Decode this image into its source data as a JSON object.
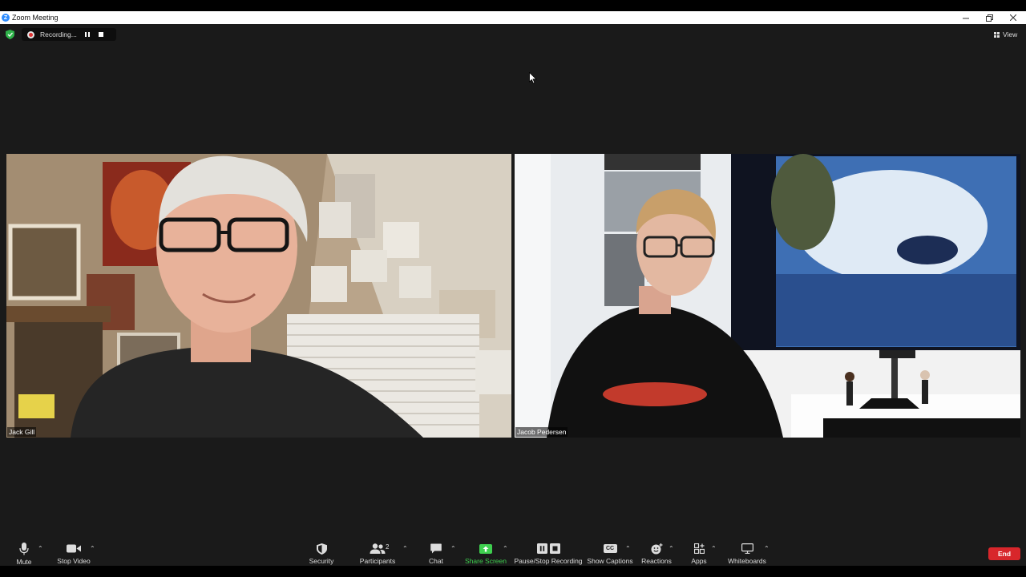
{
  "window": {
    "title": "Zoom Meeting",
    "controls": [
      "minimize",
      "restore",
      "close"
    ]
  },
  "recording": {
    "status": "Recording...",
    "status_color": "#d33333"
  },
  "view": {
    "label": "View"
  },
  "participants": [
    {
      "name": "Jack Gill"
    },
    {
      "name": "Jacob Pedersen"
    }
  ],
  "toolbar": {
    "mute": "Mute",
    "stop_video": "Stop Video",
    "security": "Security",
    "participants": "Participants",
    "participants_count": "2",
    "chat": "Chat",
    "share_screen": "Share Screen",
    "pause_stop_recording": "Pause/Stop Recording",
    "show_captions": "Show Captions",
    "captions_icon_text": "CC",
    "reactions": "Reactions",
    "apps": "Apps",
    "whiteboards": "Whiteboards",
    "end": "End"
  },
  "colors": {
    "share_green": "#3ecf4f",
    "end_red": "#d8262b",
    "shield_green": "#2fb34a",
    "zoom_blue": "#2d8cff",
    "stage_bg": "#1a1a1a"
  }
}
